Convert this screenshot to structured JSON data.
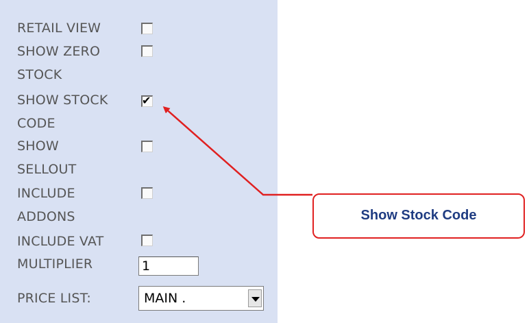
{
  "options": [
    {
      "label_line1": "RETAIL VIEW",
      "label_line2": "",
      "checked": false
    },
    {
      "label_line1": "SHOW ZERO",
      "label_line2": "STOCK",
      "checked": false
    },
    {
      "label_line1": "SHOW STOCK",
      "label_line2": "CODE",
      "checked": true
    },
    {
      "label_line1": "SHOW",
      "label_line2": "SELLOUT",
      "checked": false
    },
    {
      "label_line1": "INCLUDE",
      "label_line2": "ADDONS",
      "checked": false
    },
    {
      "label_line1": "INCLUDE VAT",
      "label_line2": "",
      "checked": false
    }
  ],
  "multiplier": {
    "label": "MULTIPLIER",
    "value": "1"
  },
  "price_list": {
    "label": "PRICE LIST:",
    "selected": "MAIN ."
  },
  "callout": {
    "text": "Show Stock Code",
    "color": "#e02020",
    "text_color": "#1f3c82"
  },
  "colors": {
    "panel_bg": "#d9e1f3",
    "label": "#555555"
  }
}
